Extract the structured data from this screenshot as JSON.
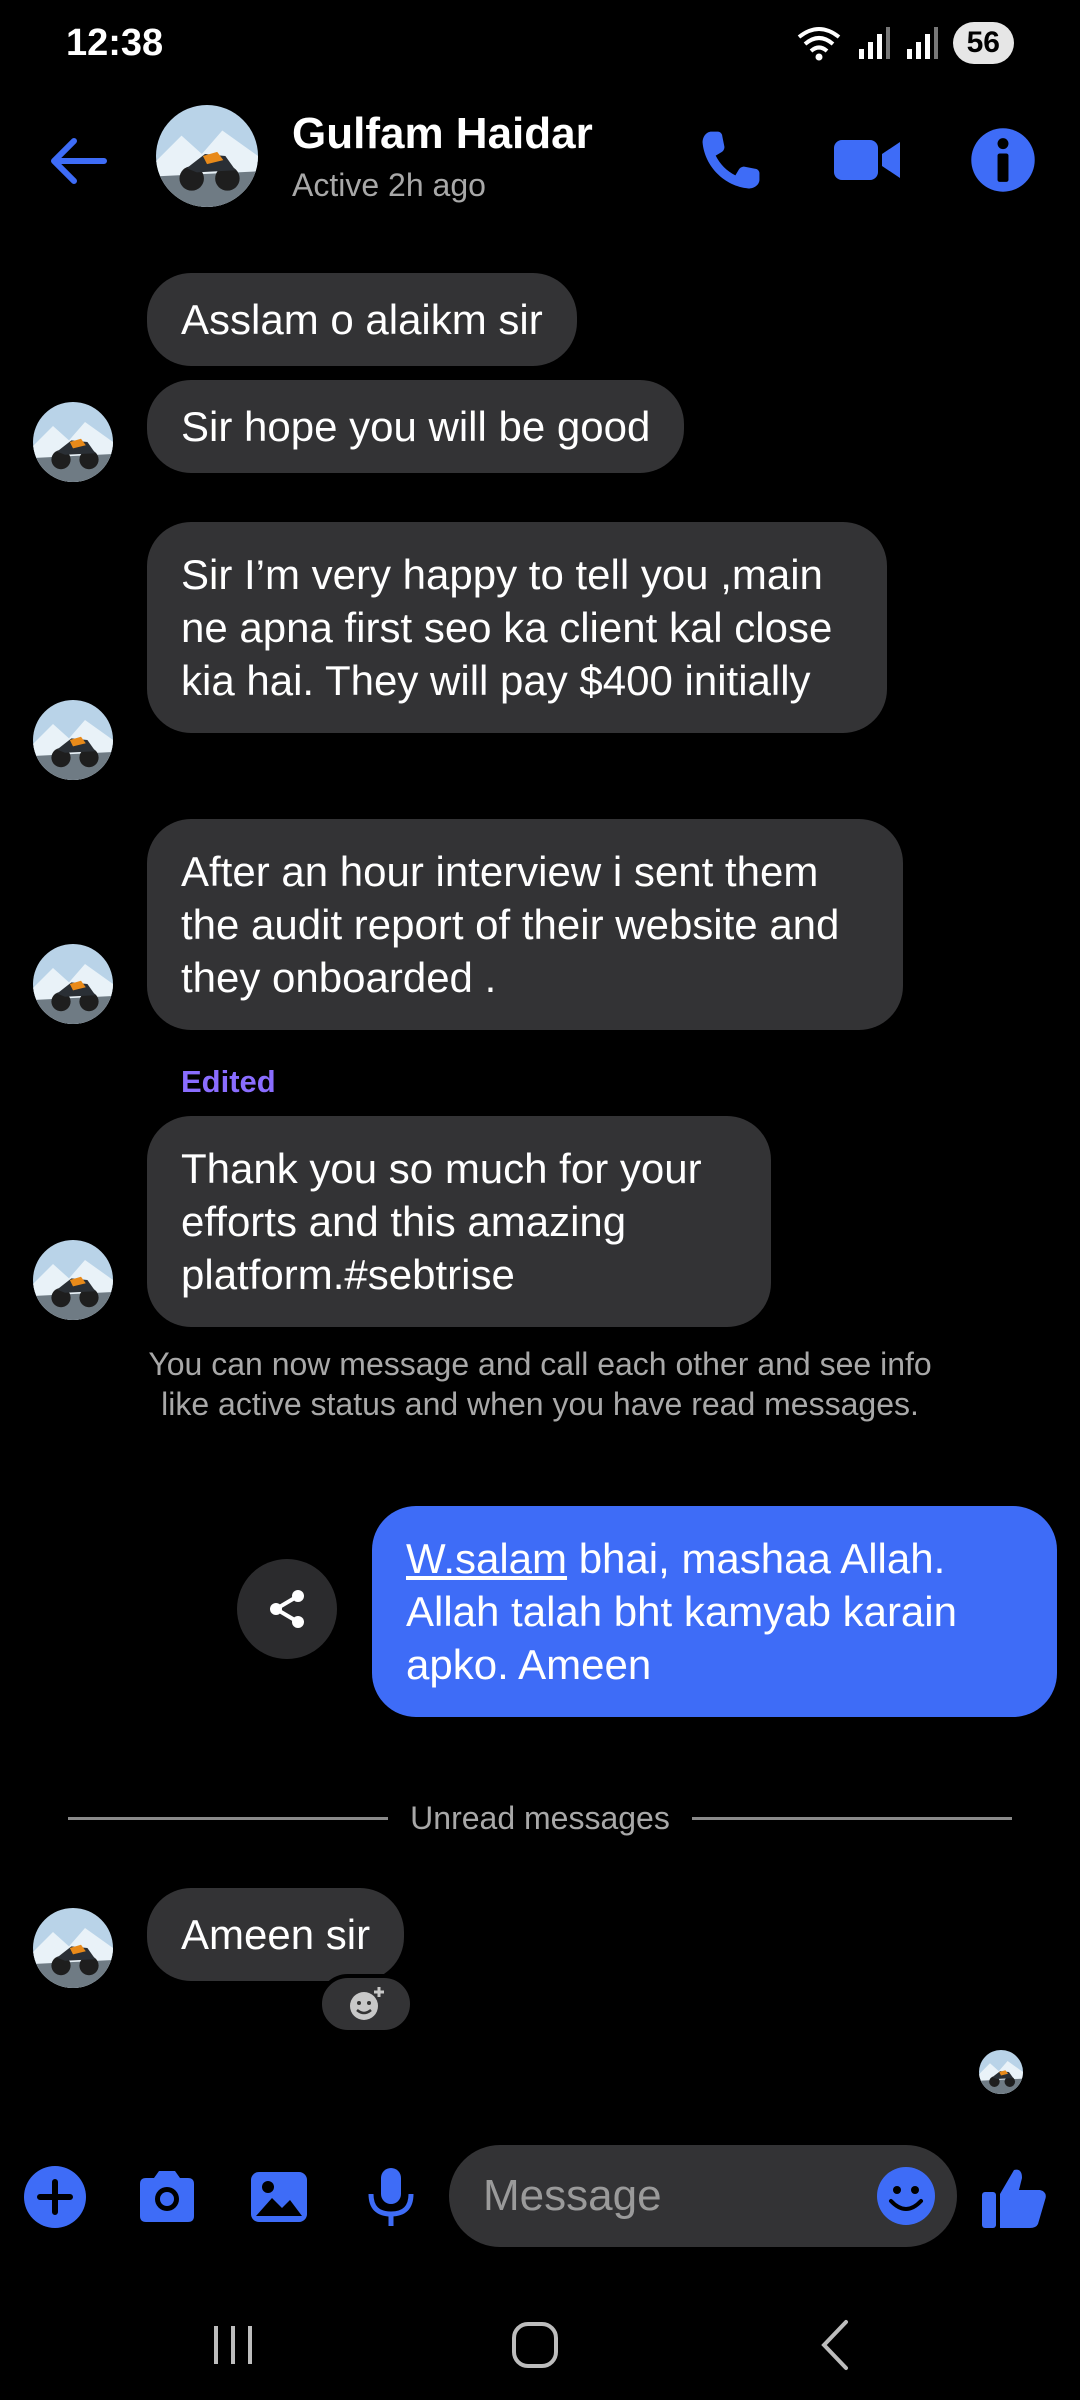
{
  "status_bar": {
    "time": "12:38",
    "battery": "56"
  },
  "header": {
    "name": "Gulfam Haidar",
    "status": "Active 2h ago"
  },
  "messages": [
    {
      "text": "Asslam o alaikm sir"
    },
    {
      "text": "Sir hope you will be good"
    },
    {
      "text": "Sir I’m very happy to tell you ,main ne apna first seo ka client kal close kia hai. They will pay $400 initially"
    },
    {
      "text": "After an hour interview i sent them the audit report of their website and they onboarded ."
    },
    {
      "text": "Thank you so much for your efforts and this amazing platform.#sebtrise",
      "edited_label": "Edited"
    }
  ],
  "system_note": "You can now message and call each other and see info like active status and when you have read messages.",
  "my_message": {
    "link_text": "W.salam",
    "rest_text": " bhai, mashaa Allah. Allah talah bht kamyab karain apko. Ameen"
  },
  "unread_label": "Unread messages",
  "last_message": {
    "text": "Ameen sir"
  },
  "composer": {
    "placeholder": "Message"
  },
  "colors": {
    "accent": "#3e6cf7",
    "bubble_in": "#333335",
    "edited": "#8a6dff",
    "background": "#000000"
  },
  "icons": [
    "back-arrow-icon",
    "phone-icon",
    "video-camera-icon",
    "info-icon",
    "share-icon",
    "add-reaction-icon",
    "plus-icon",
    "camera-icon",
    "gallery-icon",
    "microphone-icon",
    "emoji-icon",
    "thumbs-up-icon"
  ]
}
